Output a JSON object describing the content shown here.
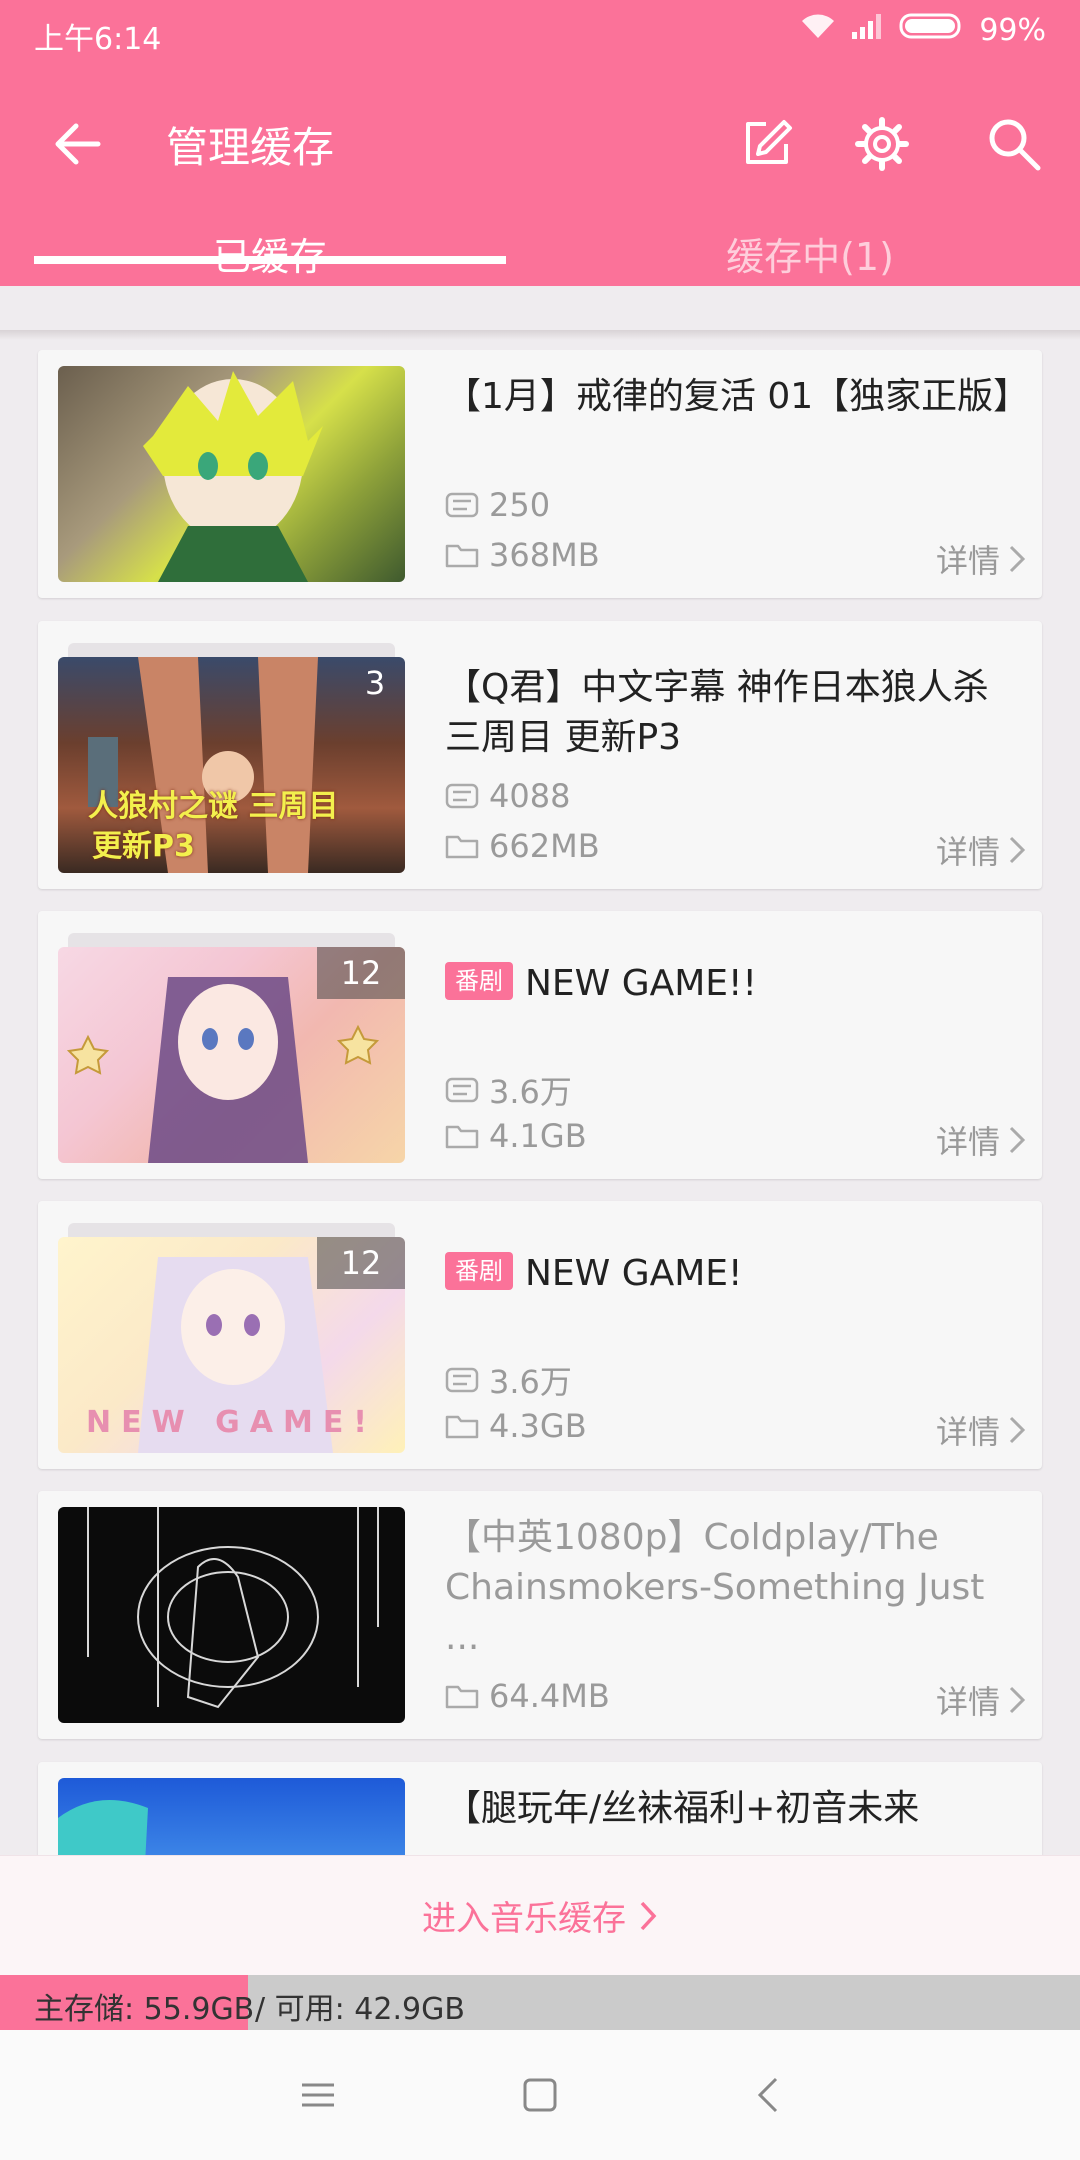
{
  "status_bar": {
    "time": "上午6:14",
    "battery": "99%"
  },
  "app_bar": {
    "title": "管理缓存"
  },
  "tabs": [
    {
      "label": "已缓存"
    },
    {
      "label": "缓存中(1)"
    }
  ],
  "items": [
    {
      "title": "【1月】戒律的复活 01【独家正版】",
      "badge": "",
      "count": "",
      "danmaku": "250",
      "size": "368MB",
      "detail": "详情"
    },
    {
      "title": "【Q君】中文字幕 神作日本狼人杀三周目 更新P3",
      "badge": "",
      "count": "3",
      "danmaku": "4088",
      "size": "662MB",
      "detail": "详情",
      "thumb_caption_line1": "人狼村之谜 三周目",
      "thumb_caption_line2": "更新P3"
    },
    {
      "title": "NEW GAME!!",
      "badge": "番剧",
      "count": "12",
      "danmaku": "3.6万",
      "size": "4.1GB",
      "detail": "详情"
    },
    {
      "title": "NEW GAME!",
      "badge": "番剧",
      "count": "12",
      "danmaku": "3.6万",
      "size": "4.3GB",
      "detail": "详情",
      "thumb_caption": "NEW GAME!"
    },
    {
      "title": "【中英1080p】Coldplay/The Chainsmokers-Something Just ...",
      "badge": "",
      "count": "",
      "danmaku": "",
      "size": "64.4MB",
      "detail": "详情"
    },
    {
      "title": "【腿玩年/丝袜福利+初音未来",
      "badge": "",
      "count": "",
      "danmaku": "",
      "size": "",
      "detail": ""
    }
  ],
  "music_cache": {
    "label": "进入音乐缓存"
  },
  "storage": {
    "main": "主存储: 55.9GB",
    "available": "/ 可用: 42.9GB",
    "used_fraction": 0.23
  },
  "colors": {
    "accent": "#fb7299"
  }
}
